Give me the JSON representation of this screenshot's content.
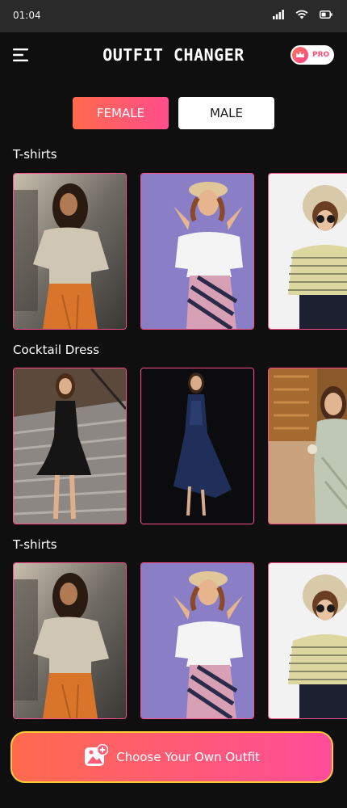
{
  "status_bar": {
    "time": "01:04"
  },
  "header": {
    "title": "OUTFIT CHANGER",
    "pro_label": "PRO"
  },
  "gender": {
    "female": "FEMALE",
    "male": "MALE",
    "selected": "FEMALE"
  },
  "sections": [
    {
      "title": "T-shirts"
    },
    {
      "title": "Cocktail Dress"
    },
    {
      "title": "T-shirts"
    }
  ],
  "cta": {
    "label": "Choose Your Own Outfit"
  },
  "colors": {
    "accent_start": "#ff6a4d",
    "accent_end": "#ff4d8d",
    "cta_border": "#ffcc33",
    "background": "#0f0f0f"
  }
}
